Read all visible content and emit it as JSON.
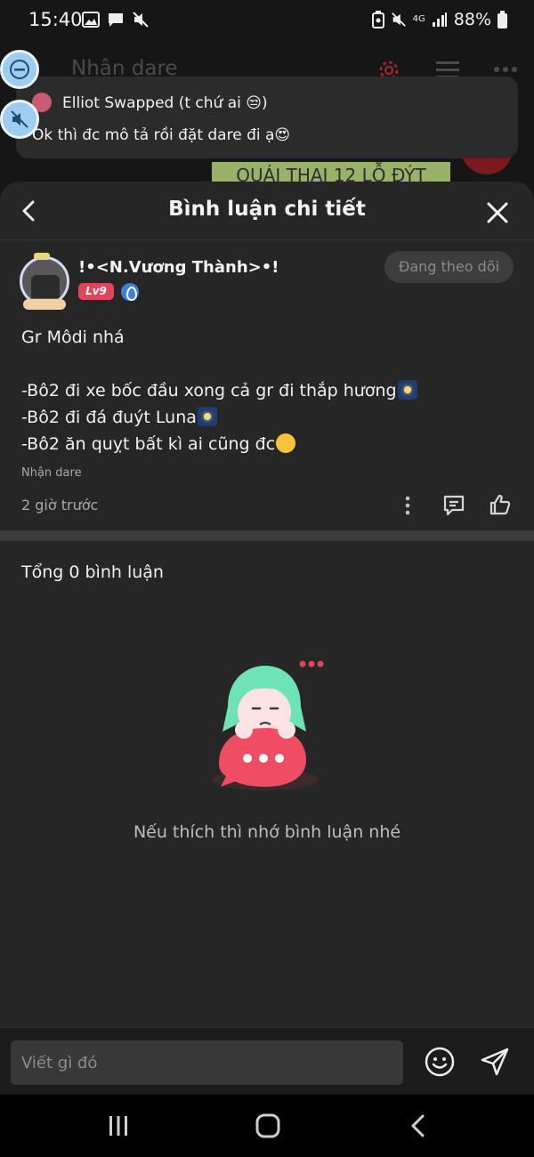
{
  "status_bar": {
    "time": "15:40",
    "network": "4G",
    "battery": "88%"
  },
  "background_chat": {
    "title": "Nhận dare",
    "sticker_text": "QUÁI THAI 12 LỖ ĐÝT"
  },
  "notification": {
    "sender": "Elliot Swapped (t chứ ai 😒)",
    "message": "Ok thì đc mô tả rồi đặt dare đi ạ😍"
  },
  "header": {
    "title": "Bình luận chi tiết"
  },
  "post": {
    "author": "!•<N.Vương Thành>•!",
    "level_badge": "Lv9",
    "follow_label": "Đang theo dõi",
    "lines": [
      "Gr Môdi nhá",
      "",
      "-Bô2 đi xe bốc đầu xong cả gr đi thắp hương",
      "-Bô2 đi đá đuýt Luna",
      "-Bô2 ăn quỵt bất kì ai cũng đc"
    ],
    "tag": "Nhận dare",
    "time_ago": "2 giờ trước"
  },
  "comments": {
    "total_label": "Tổng 0 bình luận",
    "empty_text": "Nếu thích thì nhớ bình luận nhé"
  },
  "composer": {
    "placeholder": "Viết gì đó"
  },
  "colors": {
    "sheet_bg": "#262626",
    "accent_red": "#e0455c",
    "verify_blue": "#3c7ed8",
    "illus_green": "#6fe3b8"
  }
}
